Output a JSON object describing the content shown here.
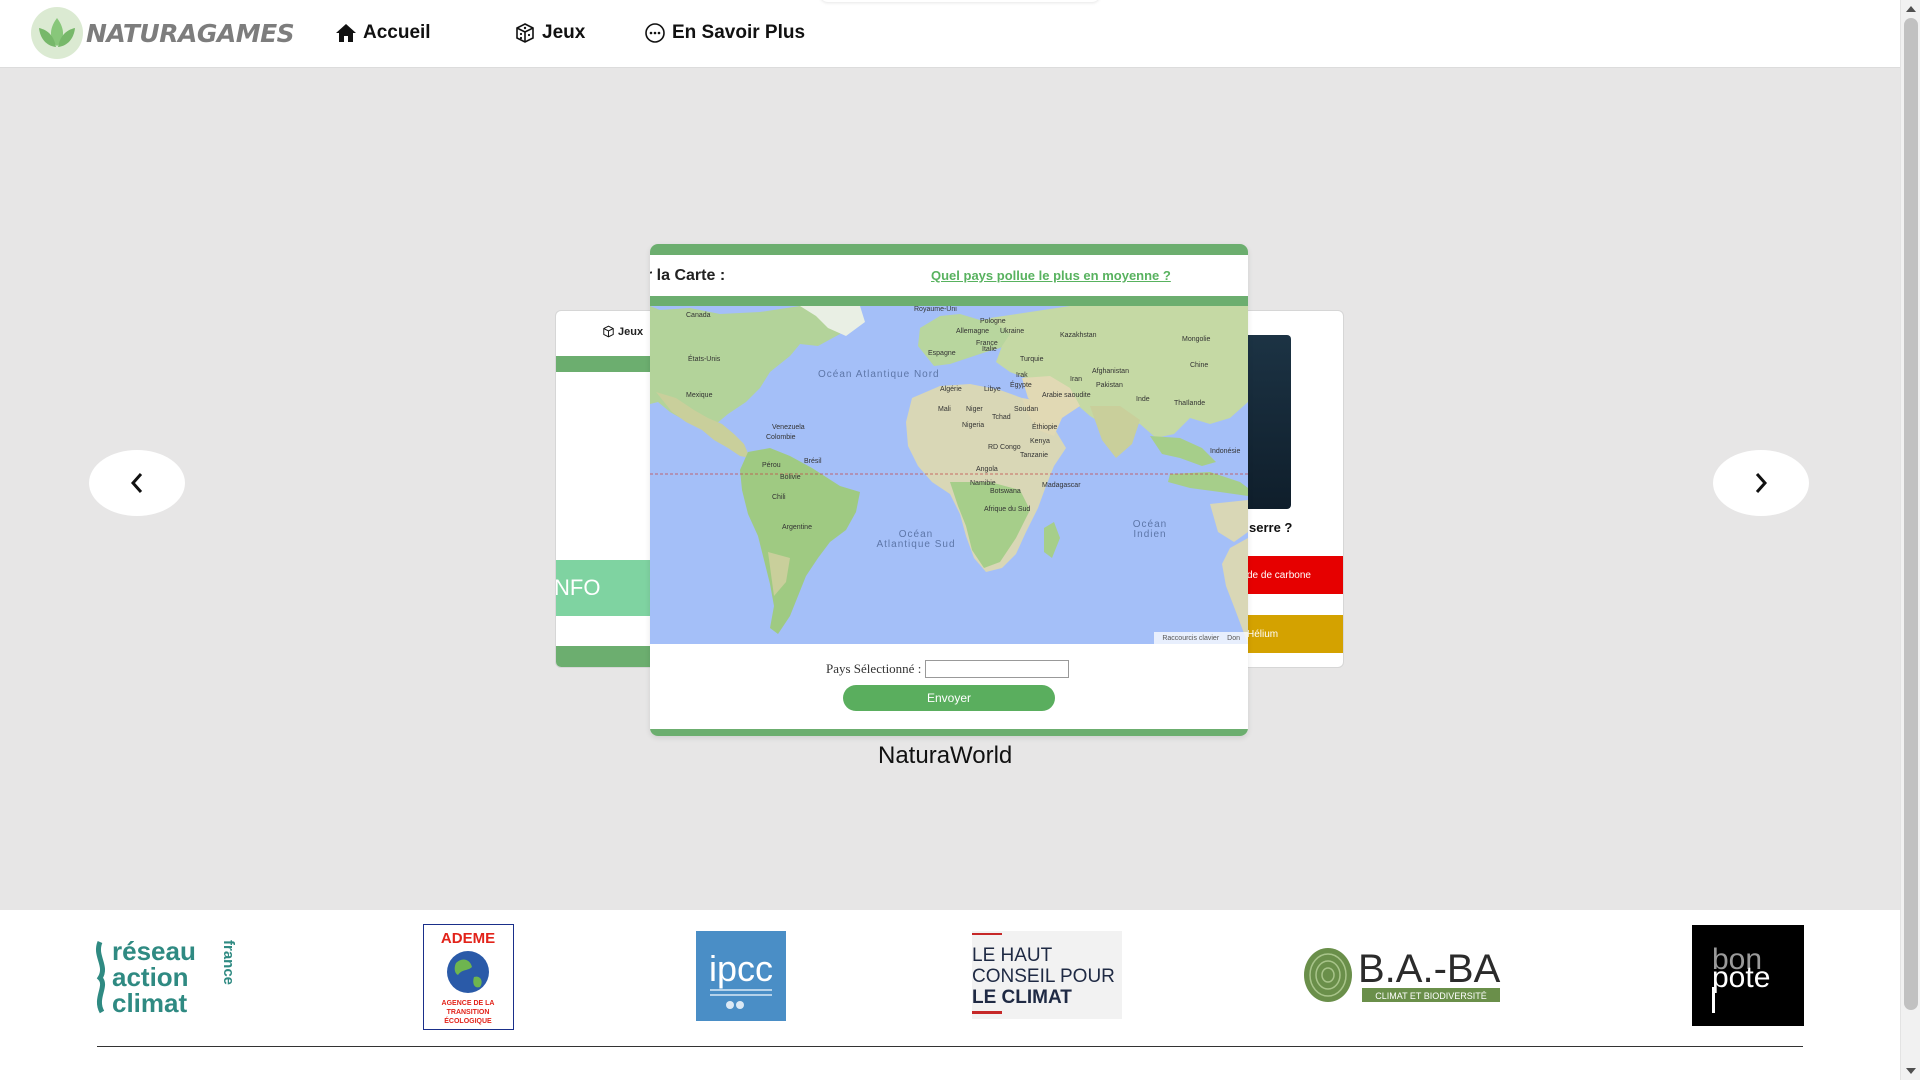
{
  "brand": {
    "name": "NATURAGAMES"
  },
  "nav": {
    "home": "Accueil",
    "games": "Jeux",
    "more": "En Savoir Plus"
  },
  "carousel": {
    "prev_icon": "chevron-left-icon",
    "next_icon": "chevron-right-icon",
    "left_card": {
      "header": "Jeux",
      "button": "NFO"
    },
    "right_card": {
      "question": "serre ?",
      "answer_red": "de de carbone",
      "answer_yellow": "Hélium"
    },
    "active_card": {
      "title": "r la Carte :",
      "link": "Quel pays pollue le plus en moyenne ?",
      "map": {
        "labels": [
          "Canada",
          "Royaume-Uni",
          "Pologne",
          "Allemagne",
          "Ukraine",
          "Kazakhstan",
          "France",
          "Mongolie",
          "Espagne",
          "Italie",
          "États-Unis",
          "Turquie",
          "Chine",
          "Irak",
          "Iran",
          "Afghanistan",
          "Algérie",
          "Libye",
          "Égypte",
          "Pakistan",
          "Mexique",
          "Arabie saoudite",
          "Inde",
          "Thaïlande",
          "Mali",
          "Niger",
          "Tchad",
          "Soudan",
          "Venezuela",
          "Nigeria",
          "Éthiopie",
          "Colombie",
          "Kenya",
          "RD Congo",
          "Indonésie",
          "Tanzanie",
          "Pérou",
          "Brésil",
          "Angola",
          "Bolivie",
          "Namibie",
          "Madagascar",
          "Botswana",
          "Chili",
          "Afrique du Sud",
          "Argentine"
        ],
        "oceans": [
          "Océan Atlantique Nord",
          "Océan Atlantique Sud",
          "Océan Indien"
        ],
        "footer": [
          "Raccourcis clavier",
          "Don"
        ]
      },
      "form_label": "Pays Sélectionné :",
      "form_value": "",
      "submit": "Envoyer"
    },
    "active_name": "NaturaWorld"
  },
  "partners": [
    {
      "name": "réseau action climat france",
      "lines": [
        "réseau",
        "action",
        "climat"
      ],
      "side": "france"
    },
    {
      "name": "ADEME",
      "top": "ADEME",
      "bottom": [
        "AGENCE DE LA",
        "TRANSITION",
        "ÉCOLOGIQUE"
      ]
    },
    {
      "name": "ipcc",
      "top": "ipcc"
    },
    {
      "name": "Le Haut Conseil pour le Climat",
      "lines": [
        "LE HAUT",
        "CONSEIL POUR",
        "LE CLIMAT"
      ]
    },
    {
      "name": "B.A.-BA",
      "top": "B.A.-BA",
      "sub": "CLIMAT ET BIODIVERSITÉ"
    },
    {
      "name": "bon pote",
      "lines": [
        "bon",
        "pote"
      ]
    }
  ],
  "colors": {
    "green": "#6cae6f",
    "link_green": "#58b25f",
    "mint": "#7fd3a1",
    "red": "#e60000",
    "yellow": "#d4a200",
    "ocean": "#a4bff8"
  }
}
